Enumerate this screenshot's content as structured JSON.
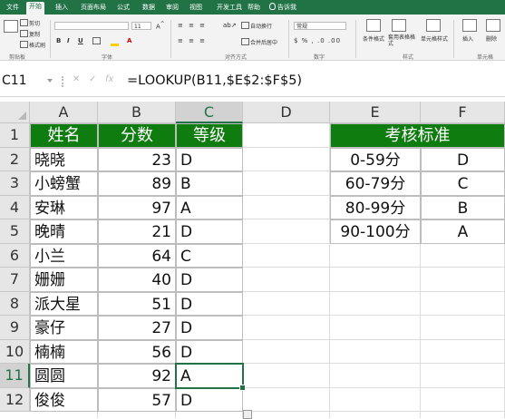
{
  "ribbon_tabs": [
    "文件",
    "开始",
    "插入",
    "页面布局",
    "公式",
    "数据",
    "审阅",
    "视图",
    "开发工具",
    "帮助",
    "告诉我"
  ],
  "ribbon": {
    "clipboard": {
      "cut": "剪切",
      "copy": "复制",
      "paint": "格式刷",
      "label": "剪贴板"
    },
    "font": {
      "name": "",
      "size": "11",
      "bold": "B",
      "italic": "I",
      "underline": "U",
      "label": "字体"
    },
    "alignment": {
      "wrap": "自动换行",
      "merge": "合并后居中",
      "label": "对齐方式"
    },
    "number": {
      "format": "常规",
      "label": "数字"
    },
    "styles": {
      "cond": "条件格式",
      "table": "套用表格格式",
      "cellstyle": "单元格样式",
      "label": "样式"
    },
    "cells": {
      "insert": "插入",
      "delete": "删除",
      "label": "单元格"
    }
  },
  "formula_bar": {
    "name_box": "C11",
    "formula": "=LOOKUP(B11,$E$2:$F$5)"
  },
  "columns": [
    "A",
    "B",
    "C",
    "D",
    "E",
    "F"
  ],
  "rows": [
    "1",
    "2",
    "3",
    "4",
    "5",
    "6",
    "7",
    "8",
    "9",
    "10",
    "11",
    "12"
  ],
  "table_main": {
    "headers": [
      "姓名",
      "分数",
      "等级"
    ],
    "rows": [
      [
        "晓晓",
        "23",
        "D"
      ],
      [
        "小螃蟹",
        "89",
        "B"
      ],
      [
        "安琳",
        "97",
        "A"
      ],
      [
        "晚晴",
        "21",
        "D"
      ],
      [
        "小兰",
        "64",
        "C"
      ],
      [
        "姗姗",
        "40",
        "D"
      ],
      [
        "派大星",
        "51",
        "D"
      ],
      [
        "豪仔",
        "27",
        "D"
      ],
      [
        "楠楠",
        "56",
        "D"
      ],
      [
        "圆圆",
        "92",
        "A"
      ],
      [
        "俊俊",
        "57",
        "D"
      ]
    ]
  },
  "table_criteria": {
    "title": "考核标准",
    "rows": [
      [
        "0-59分",
        "D"
      ],
      [
        "60-79分",
        "C"
      ],
      [
        "80-99分",
        "B"
      ],
      [
        "90-100分",
        "A"
      ]
    ]
  },
  "active_cell": "C11",
  "colors": {
    "accent": "#217346",
    "header_fill": "#0f7c0f"
  }
}
